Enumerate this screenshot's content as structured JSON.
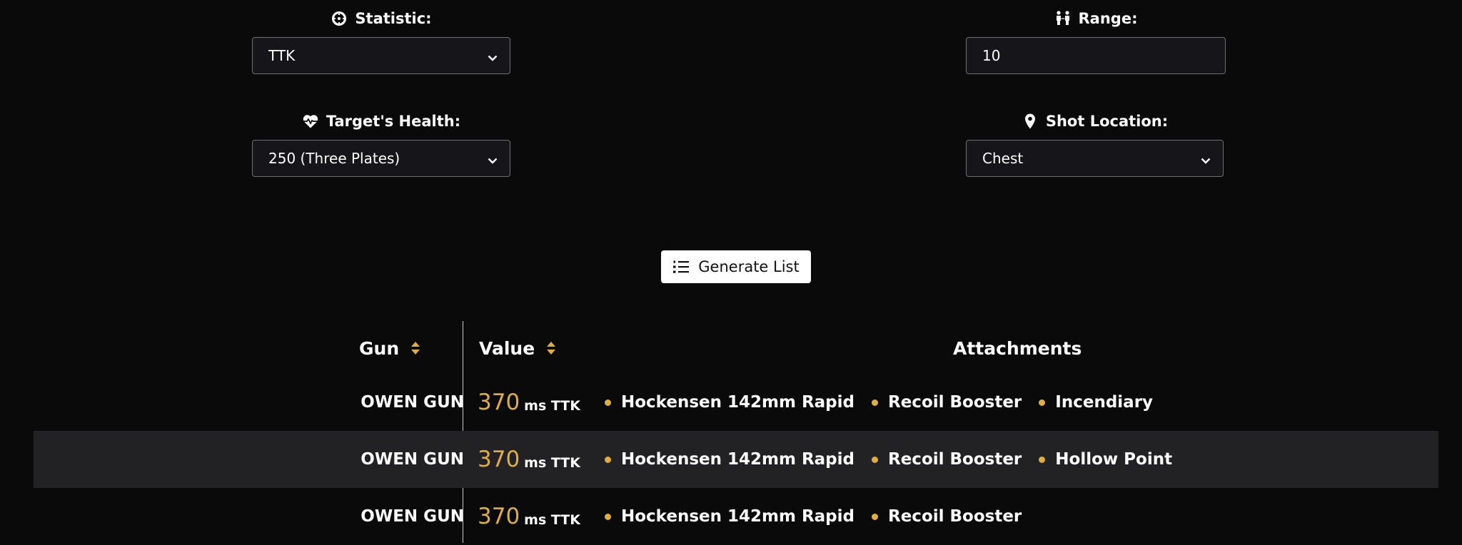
{
  "colors": {
    "accent": "#e0ae3a",
    "background": "#0a0a0b",
    "alt_row": "#222224",
    "control_bg": "#16161a"
  },
  "filters": {
    "statistic": {
      "label": "Statistic:",
      "value": "TTK",
      "icon": "crosshair-icon"
    },
    "range": {
      "label": "Range:",
      "value": "10",
      "icon": "people-range-icon"
    },
    "target_health": {
      "label": "Target's Health:",
      "value": "250 (Three Plates)",
      "icon": "heartbeat-icon"
    },
    "shot_location": {
      "label": "Shot Location:",
      "value": "Chest",
      "icon": "map-pin-icon"
    }
  },
  "generate_button": {
    "label": "Generate List",
    "icon": "list-icon"
  },
  "table": {
    "headers": {
      "gun": "Gun",
      "value": "Value",
      "attachments": "Attachments"
    },
    "rows": [
      {
        "gun": "OWEN GUN",
        "value": "370",
        "unit": "ms TTK",
        "attachments": [
          "Hockensen 142mm Rapid",
          "Recoil Booster",
          "Incendiary"
        ]
      },
      {
        "gun": "OWEN GUN",
        "value": "370",
        "unit": "ms TTK",
        "attachments": [
          "Hockensen 142mm Rapid",
          "Recoil Booster",
          "Hollow Point"
        ]
      },
      {
        "gun": "OWEN GUN",
        "value": "370",
        "unit": "ms TTK",
        "attachments": [
          "Hockensen 142mm Rapid",
          "Recoil Booster"
        ]
      }
    ]
  }
}
